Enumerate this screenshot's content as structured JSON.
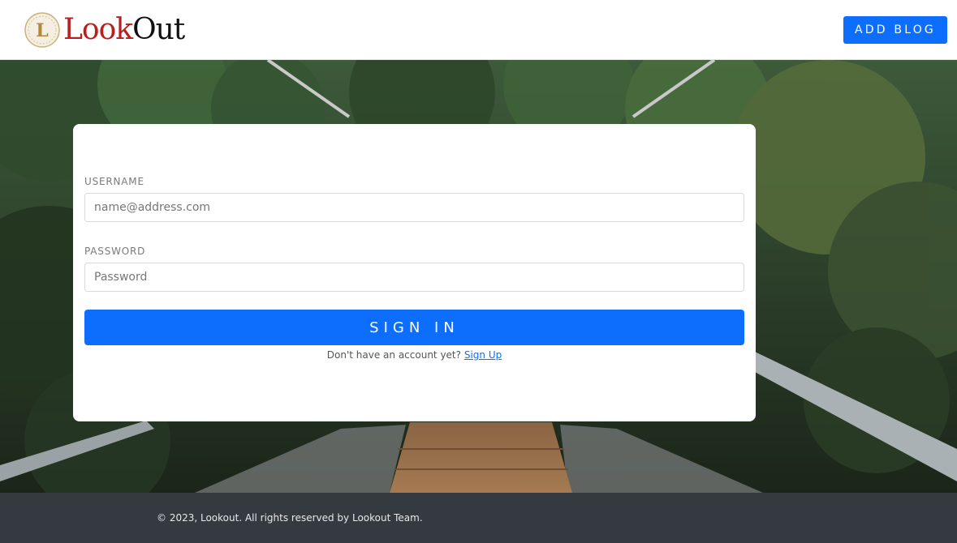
{
  "header": {
    "brand": {
      "logo_initial": "L",
      "name_part1": "Look",
      "name_part2": "Out"
    },
    "add_blog_label": "ADD BLOG"
  },
  "login": {
    "username_label": "USERNAME",
    "username_placeholder": "name@address.com",
    "password_label": "PASSWORD",
    "password_placeholder": "Password",
    "signin_label": "SIGN IN",
    "signup_prompt": "Don't have an account yet?",
    "signup_link": "Sign Up"
  },
  "footer": {
    "text": "© 2023, Lookout. All rights reserved by Lookout Team."
  },
  "colors": {
    "primary": "#0d6efd",
    "footer_bg": "#343a40",
    "brand_red": "#b81f1f"
  }
}
